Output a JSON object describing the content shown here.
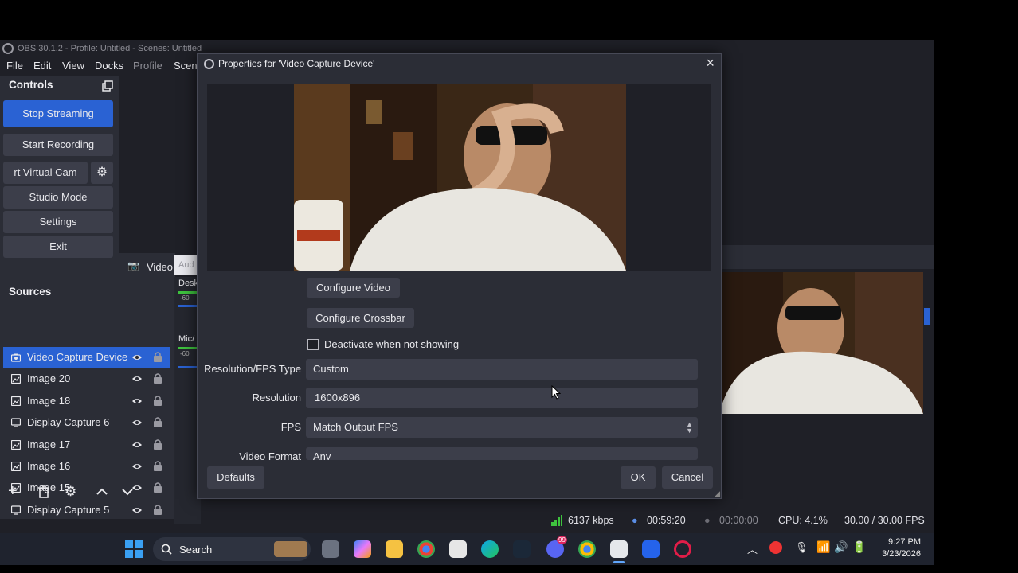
{
  "window": {
    "title": "OBS 30.1.2 - Profile: Untitled - Scenes: Untitled",
    "menu": [
      "File",
      "Edit",
      "View",
      "Docks",
      "Profile",
      "Scene"
    ]
  },
  "controls": {
    "header": "Controls",
    "buttons": [
      "Stop Streaming",
      "Start Recording",
      "rt Virtual Cam",
      "Studio Mode",
      "Settings",
      "Exit"
    ]
  },
  "scene_strip": {
    "video_tab": "Video",
    "audio_tab": "Aud"
  },
  "sources": {
    "header": "Sources",
    "items": [
      {
        "label": "Video Capture Device",
        "icon": "camera-icon"
      },
      {
        "label": "Image 20",
        "icon": "image-icon"
      },
      {
        "label": "Image 18",
        "icon": "image-icon"
      },
      {
        "label": "Display Capture 6",
        "icon": "monitor-icon"
      },
      {
        "label": "Image 17",
        "icon": "image-icon"
      },
      {
        "label": "Image 16",
        "icon": "image-icon"
      },
      {
        "label": "Image 15",
        "icon": "image-icon"
      },
      {
        "label": "Display Capture 5",
        "icon": "monitor-icon"
      }
    ]
  },
  "mixer": {
    "ch1": "Desk",
    "ch1_level": "-60",
    "ch2": "Mic/",
    "ch2_level": "-60"
  },
  "dialog": {
    "title": "Properties for 'Video Capture Device'",
    "configure_video": "Configure Video",
    "configure_crossbar": "Configure Crossbar",
    "deactivate_label": "Deactivate when not showing",
    "fields": [
      {
        "label": "Resolution/FPS Type",
        "value": "Custom"
      },
      {
        "label": "Resolution",
        "value": "1600x896"
      },
      {
        "label": "FPS",
        "value": "Match Output FPS"
      },
      {
        "label": "Video Format",
        "value": "Any"
      }
    ],
    "defaults": "Defaults",
    "ok": "OK",
    "cancel": "Cancel"
  },
  "status": {
    "bitrate": "6137 kbps",
    "stream_time": "00:59:20",
    "rec_time": "00:00:00",
    "cpu": "CPU: 4.1%",
    "fps": "30.00 / 30.00 FPS"
  },
  "taskbar": {
    "search": "Search",
    "time": "9:27 PM",
    "date": "3/23/2026",
    "badge": "99"
  },
  "colors": {
    "accent": "#2a62d3",
    "panel": "#2b2d36",
    "button": "#3c3e4a",
    "bitrate_green": "#3ec33e"
  }
}
